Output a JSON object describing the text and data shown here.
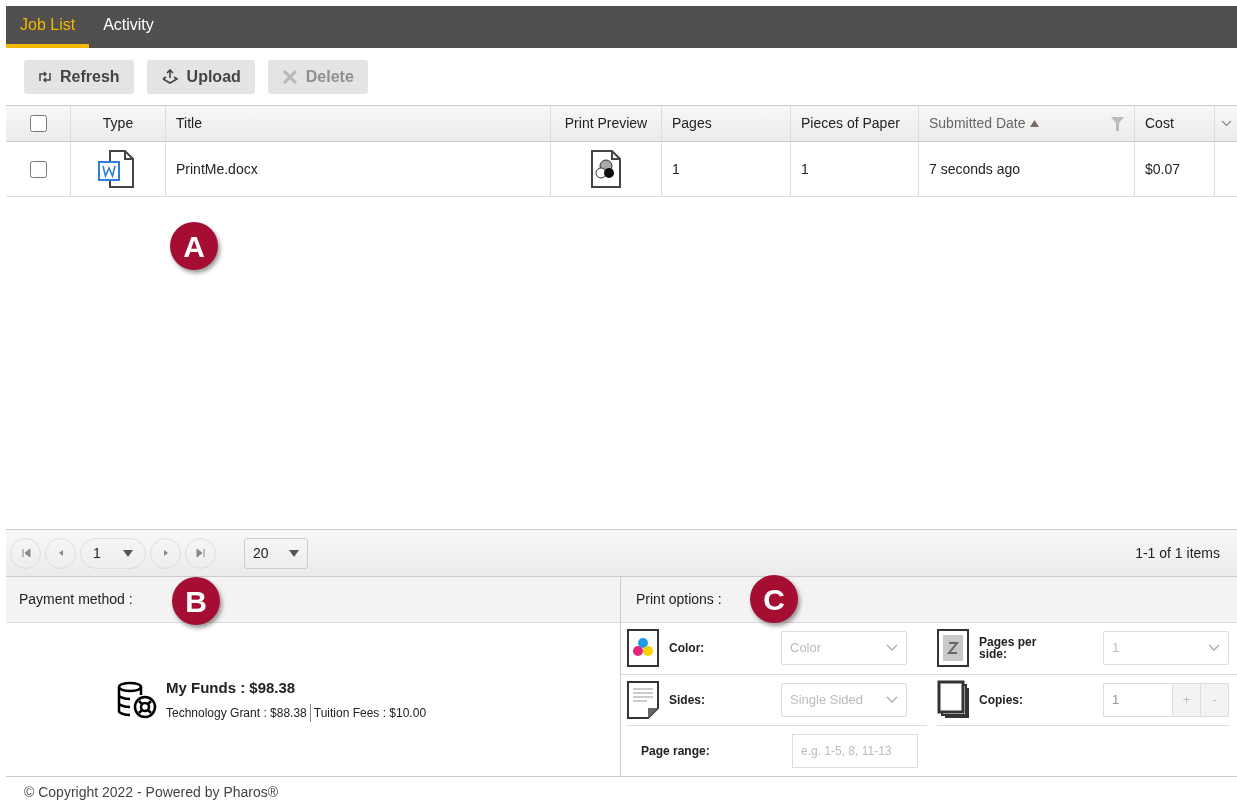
{
  "tabs": [
    {
      "label": "Job List",
      "selected": true
    },
    {
      "label": "Activity",
      "selected": false
    }
  ],
  "toolbar": [
    {
      "kind": "refresh",
      "label": "Refresh",
      "disabled": false
    },
    {
      "kind": "upload",
      "label": "Upload",
      "disabled": false
    },
    {
      "kind": "delete",
      "label": "Delete",
      "disabled": true
    }
  ],
  "table": {
    "select_all_checked": false,
    "columns": [
      {
        "kind": "type",
        "label": "Type"
      },
      {
        "kind": "title",
        "label": "Title"
      },
      {
        "kind": "preview",
        "label": "Print Preview"
      },
      {
        "kind": "pages",
        "label": "Pages"
      },
      {
        "kind": "pieces",
        "label": "Pieces of Paper"
      },
      {
        "kind": "date",
        "label": "Submitted Date",
        "sorted": true
      },
      {
        "kind": "cost",
        "label": "Cost"
      }
    ],
    "rows": [
      {
        "checked": false,
        "title": "PrintMe.docx",
        "pages": "1",
        "pieces": "1",
        "date": "7 seconds ago",
        "cost": "$0.07"
      }
    ]
  },
  "pager": {
    "page": "1",
    "page_size": "20",
    "summary": "1-1 of 1 items"
  },
  "callouts": [
    {
      "label": "A"
    },
    {
      "label": "B"
    },
    {
      "label": "C"
    }
  ],
  "payment": {
    "heading": "Payment method :",
    "title": "My Funds : $98.38",
    "parts": [
      "Technology Grant : $88.38",
      "Tuition Fees : $10.00"
    ]
  },
  "print_options": {
    "heading": "Print options :",
    "color": {
      "label": "Color:",
      "value": "Color"
    },
    "pages_per_side": {
      "label": "Pages per side:",
      "value": "1"
    },
    "sides": {
      "label": "Sides:",
      "value": "Single Sided"
    },
    "copies": {
      "label": "Copies:",
      "value": "1",
      "plus": "+",
      "minus": "-"
    },
    "page_range": {
      "label": "Page range:",
      "placeholder": "e.g. 1-5, 8, 11-13"
    }
  },
  "footer": "© Copyright 2022 - Powered by Pharos®"
}
